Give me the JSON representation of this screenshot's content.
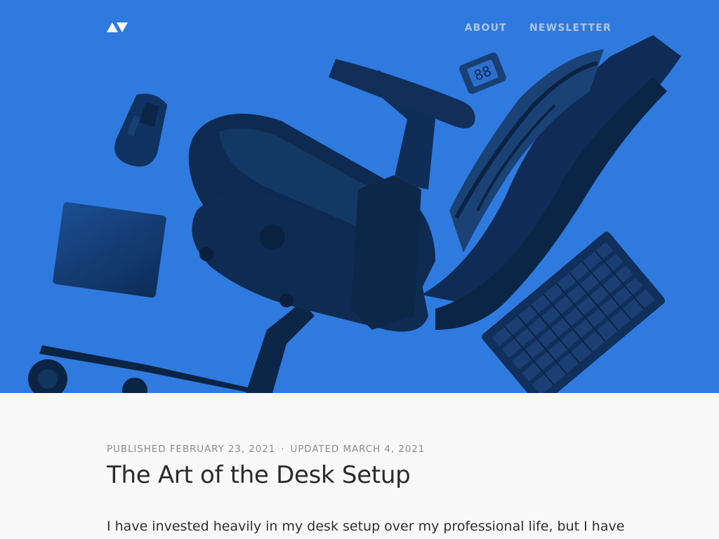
{
  "site": {
    "logo_icon": "av-logo-icon",
    "nav": [
      {
        "label": "ABOUT"
      },
      {
        "label": "NEWSLETTER"
      }
    ]
  },
  "hero": {
    "background": "#2f7adf",
    "icons": [
      "office-chair-icon",
      "mouse-icon",
      "trackpad-icon",
      "keyboard-icon",
      "clock-icon"
    ]
  },
  "article": {
    "published": "PUBLISHED FEBRUARY 23, 2021",
    "separator": "·",
    "updated": "UPDATED MARCH 4, 2021",
    "title": "The Art of the Desk Setup",
    "lead": "I have invested heavily in my desk setup over my professional life, but I have"
  },
  "colors": {
    "accent": "#2f7adf",
    "nav_text": "#a8c6ee",
    "meta_text": "#8c8c8c",
    "title_text": "#2b2b2b",
    "page_bg": "#f9f9f9"
  }
}
